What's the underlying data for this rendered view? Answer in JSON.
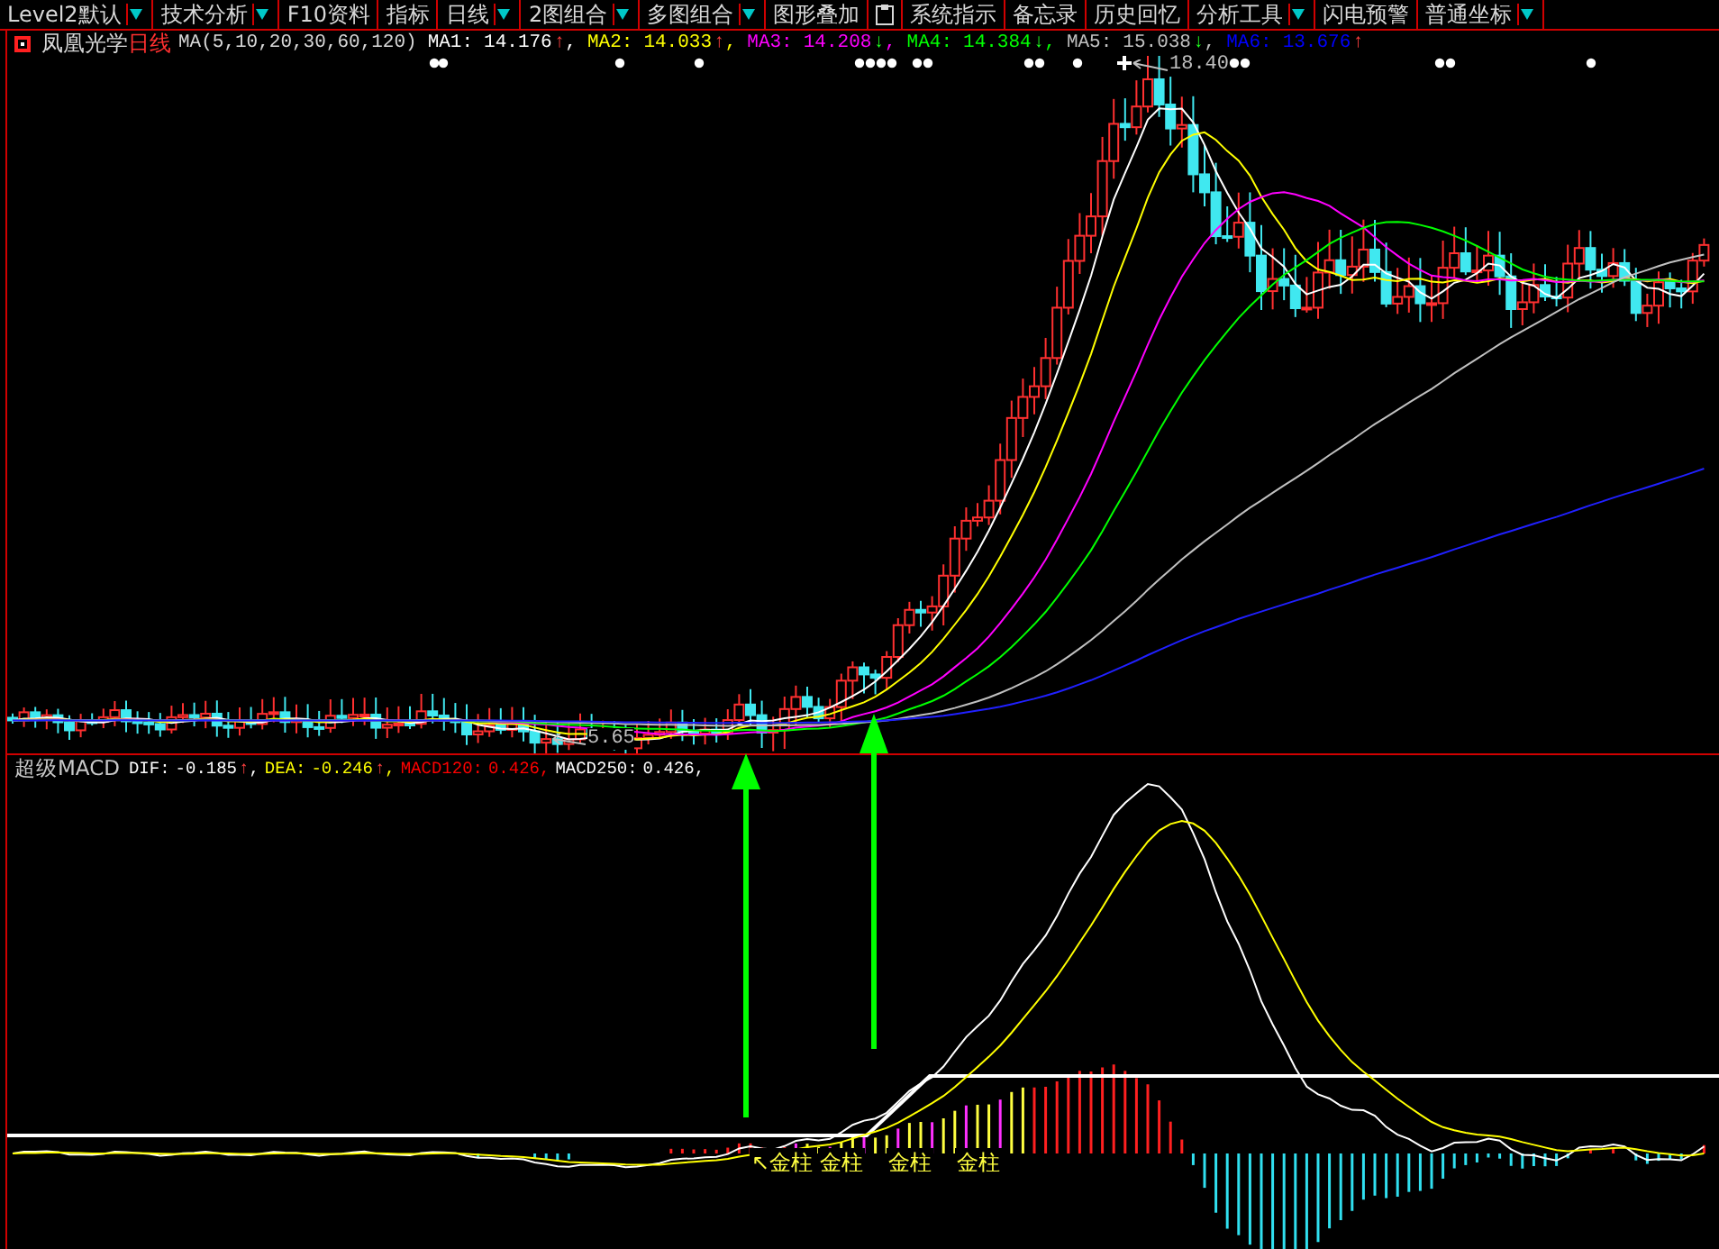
{
  "toolbar": {
    "items": [
      {
        "kind": "text",
        "label": "Level2默认",
        "dropdown": true
      },
      {
        "kind": "text",
        "label": "技术分析",
        "dropdown": true
      },
      {
        "kind": "text",
        "label": "F10资料",
        "dropdown": false
      },
      {
        "kind": "text",
        "label": "指标",
        "dropdown": false
      },
      {
        "kind": "text",
        "label": "日线",
        "dropdown": true
      },
      {
        "kind": "text",
        "label": "2图组合",
        "dropdown": true
      },
      {
        "kind": "text",
        "label": "多图组合",
        "dropdown": true
      },
      {
        "kind": "text",
        "label": "图形叠加",
        "dropdown": false
      },
      {
        "kind": "icon",
        "dropdown": false
      },
      {
        "kind": "text",
        "label": "系统指示",
        "dropdown": false
      },
      {
        "kind": "text",
        "label": "备忘录",
        "dropdown": false
      },
      {
        "kind": "text",
        "label": "历史回忆",
        "dropdown": false
      },
      {
        "kind": "text",
        "label": "分析工具",
        "dropdown": true
      },
      {
        "kind": "text",
        "label": "闪电预警",
        "dropdown": false
      },
      {
        "kind": "text",
        "label": "普通坐标",
        "dropdown": true
      }
    ]
  },
  "price_panel": {
    "stock_name": "凤凰光学",
    "period": "日线",
    "ma_label": "MA(5,10,20,30,60,120)",
    "indicators": [
      {
        "label": "MA1:",
        "value": "14.176",
        "arrow": "↑",
        "rising": true,
        "tail": ",",
        "color": "#ffffff"
      },
      {
        "label": "MA2:",
        "value": "14.033",
        "arrow": "↑",
        "rising": true,
        "tail": ",",
        "color": "#ffff00"
      },
      {
        "label": "MA3:",
        "value": "14.208",
        "arrow": "↓",
        "rising": false,
        "tail": ",",
        "color": "#ff00ff"
      },
      {
        "label": "MA4:",
        "value": "14.384",
        "arrow": "↓",
        "rising": false,
        "tail": ",",
        "color": "#00ff00"
      },
      {
        "label": "MA5:",
        "value": "15.038",
        "arrow": "↓",
        "rising": false,
        "tail": ",",
        "color": "#c0c0c0"
      },
      {
        "label": "MA6:",
        "value": "13.676",
        "arrow": "↑",
        "rising": true,
        "color": "#0000ff"
      }
    ],
    "high_label": "18.40",
    "low_label": "5.65"
  },
  "macd_panel": {
    "title": "超级MACD",
    "indicators": [
      {
        "label": "DIF:",
        "value": "-0.185",
        "arrow": "↑",
        "rising": true,
        "tail": ",",
        "color": "#ffffff"
      },
      {
        "label": "DEA:",
        "value": "-0.246",
        "arrow": "↑",
        "rising": true,
        "tail": ",",
        "color": "#ffff00"
      },
      {
        "label": "MACD120:",
        "value": "0.426",
        "tail": ",",
        "color": "#ff0000"
      },
      {
        "label": "MACD250:",
        "value": "0.426",
        "tail": ",",
        "color": "#ffffff"
      }
    ],
    "signal_labels": [
      "↖金柱",
      "金柱",
      "金柱",
      "金柱"
    ]
  }
}
